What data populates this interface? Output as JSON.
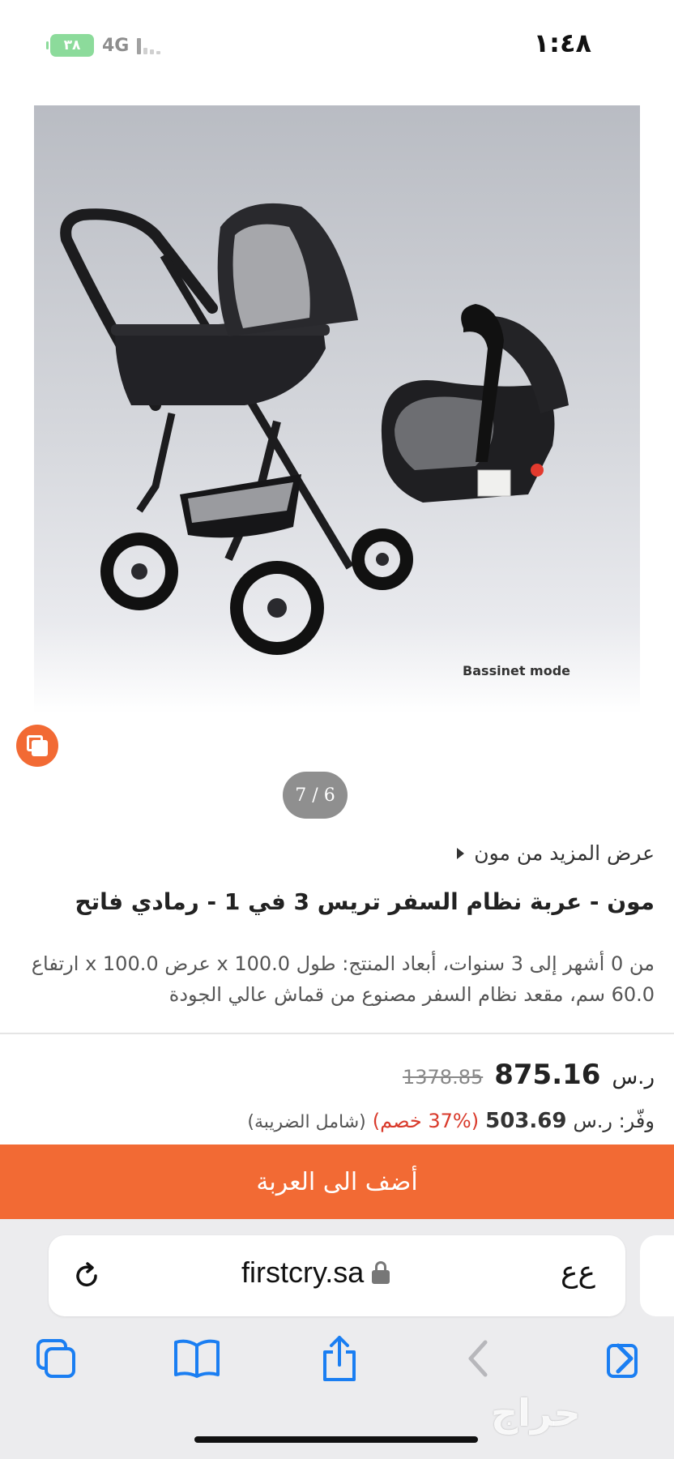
{
  "status_bar": {
    "time": "١:٤٨",
    "battery": "٣٨",
    "network": "4G"
  },
  "product": {
    "image_caption": "Bassinet mode",
    "page_indicator": "7 / 6",
    "more_from_brand": "عرض المزيد من مون",
    "title": "مون - عربة نظام السفر تريس 3 في 1 - رمادي فاتح",
    "description": "من 0 أشهر إلى 3 سنوات، أبعاد المنتج: طول 100.0 x عرض 100.0 x ارتفاع 60.0 سم، مقعد نظام السفر مصنوع من قماش عالي الجودة",
    "currency": "ر.س",
    "price": "875.16",
    "old_price": "1378.85",
    "savings_label": "وفّر: ر.س",
    "savings_amount": "503.69",
    "discount": "(37% خصم)",
    "tax_note": "(شامل الضريبة)",
    "add_to_cart": "أضف الى العربة"
  },
  "browser": {
    "url": "firstcry.sa",
    "text_size": "ﻉﻉ",
    "accent_color": "#1a7ef2"
  },
  "watermark": "حراج",
  "colors": {
    "brand_orange": "#f26a34",
    "discount_red": "#d93a2b"
  }
}
